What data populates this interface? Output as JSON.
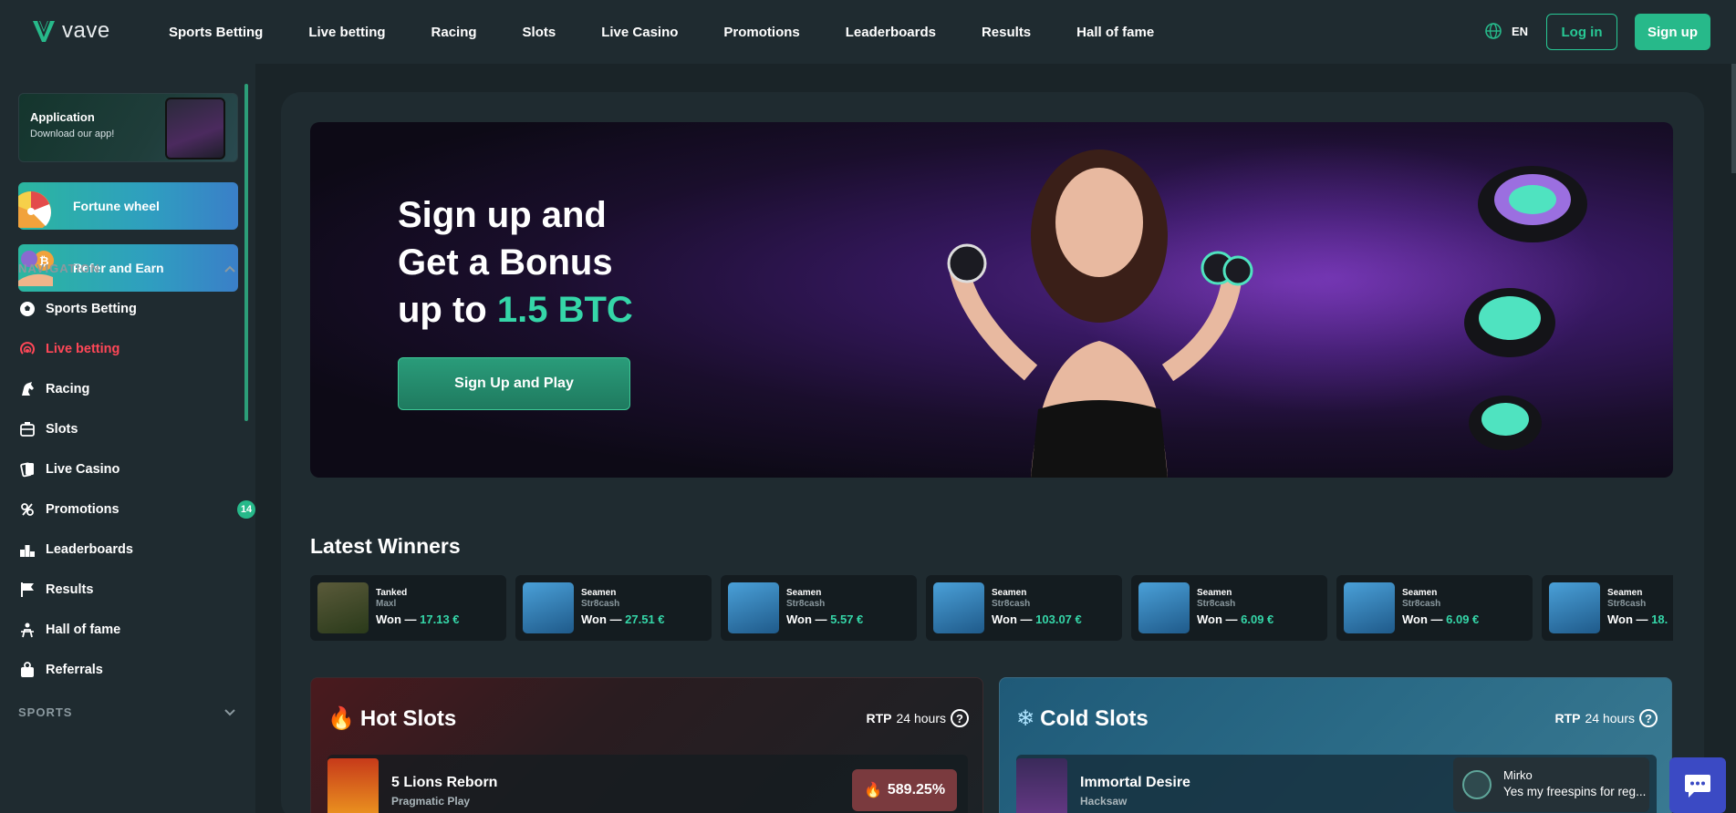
{
  "brand": {
    "name": "vave",
    "accent": "#27b98a",
    "live_color": "#ff4757"
  },
  "header": {
    "nav": [
      "Sports Betting",
      "Live betting",
      "Racing",
      "Slots",
      "Live Casino",
      "Promotions",
      "Leaderboards",
      "Results",
      "Hall of fame"
    ],
    "lang": "EN",
    "login": "Log in",
    "signup": "Sign up"
  },
  "sidebar": {
    "app": {
      "title": "Application",
      "subtitle": "Download our app!"
    },
    "promos": [
      "Fortune wheel",
      "Refer and Earn"
    ],
    "navigation_heading": "NAVIGATION",
    "items": [
      {
        "label": "Sports Betting",
        "icon": "soccer-ball-icon"
      },
      {
        "label": "Live betting",
        "icon": "live-signal-icon",
        "active": true
      },
      {
        "label": "Racing",
        "icon": "horse-icon"
      },
      {
        "label": "Slots",
        "icon": "slot-machine-icon"
      },
      {
        "label": "Live Casino",
        "icon": "cards-icon"
      },
      {
        "label": "Promotions",
        "icon": "promotions-icon",
        "badge": "14"
      },
      {
        "label": "Leaderboards",
        "icon": "leaderboard-icon"
      },
      {
        "label": "Results",
        "icon": "flag-icon"
      },
      {
        "label": "Hall of fame",
        "icon": "hall-of-fame-icon"
      },
      {
        "label": "Referrals",
        "icon": "referrals-icon"
      }
    ],
    "sports_heading": "SPORTS"
  },
  "hero": {
    "line1": "Sign up and",
    "line2": "Get a Bonus",
    "line3_prefix": "up to ",
    "line3_highlight": "1.5 BTC",
    "cta": "Sign Up and Play"
  },
  "latest_winners": {
    "title": "Latest Winners",
    "won_prefix": "Won — ",
    "items": [
      {
        "game": "Tanked",
        "provider": "Maxl",
        "amount": "17.13 €"
      },
      {
        "game": "Seamen",
        "provider": "Str8cash",
        "amount": "27.51 €"
      },
      {
        "game": "Seamen",
        "provider": "Str8cash",
        "amount": "5.57 €"
      },
      {
        "game": "Seamen",
        "provider": "Str8cash",
        "amount": "103.07 €"
      },
      {
        "game": "Seamen",
        "provider": "Str8cash",
        "amount": "6.09 €"
      },
      {
        "game": "Seamen",
        "provider": "Str8cash",
        "amount": "6.09 €"
      },
      {
        "game": "Seamen",
        "provider": "Str8cash",
        "amount": "18."
      }
    ]
  },
  "hot_slots": {
    "title": "Hot Slots",
    "rtp_label": "RTP",
    "rtp_period": "24 hours",
    "top": {
      "name": "5 Lions Reborn",
      "provider": "Pragmatic Play",
      "pct": "589.25%"
    }
  },
  "cold_slots": {
    "title": "Cold Slots",
    "rtp_label": "RTP",
    "rtp_period": "24 hours",
    "top": {
      "name": "Immortal Desire",
      "provider": "Hacksaw"
    }
  },
  "chat": {
    "name": "Mirko",
    "message": "Yes my freespins for reg..."
  }
}
